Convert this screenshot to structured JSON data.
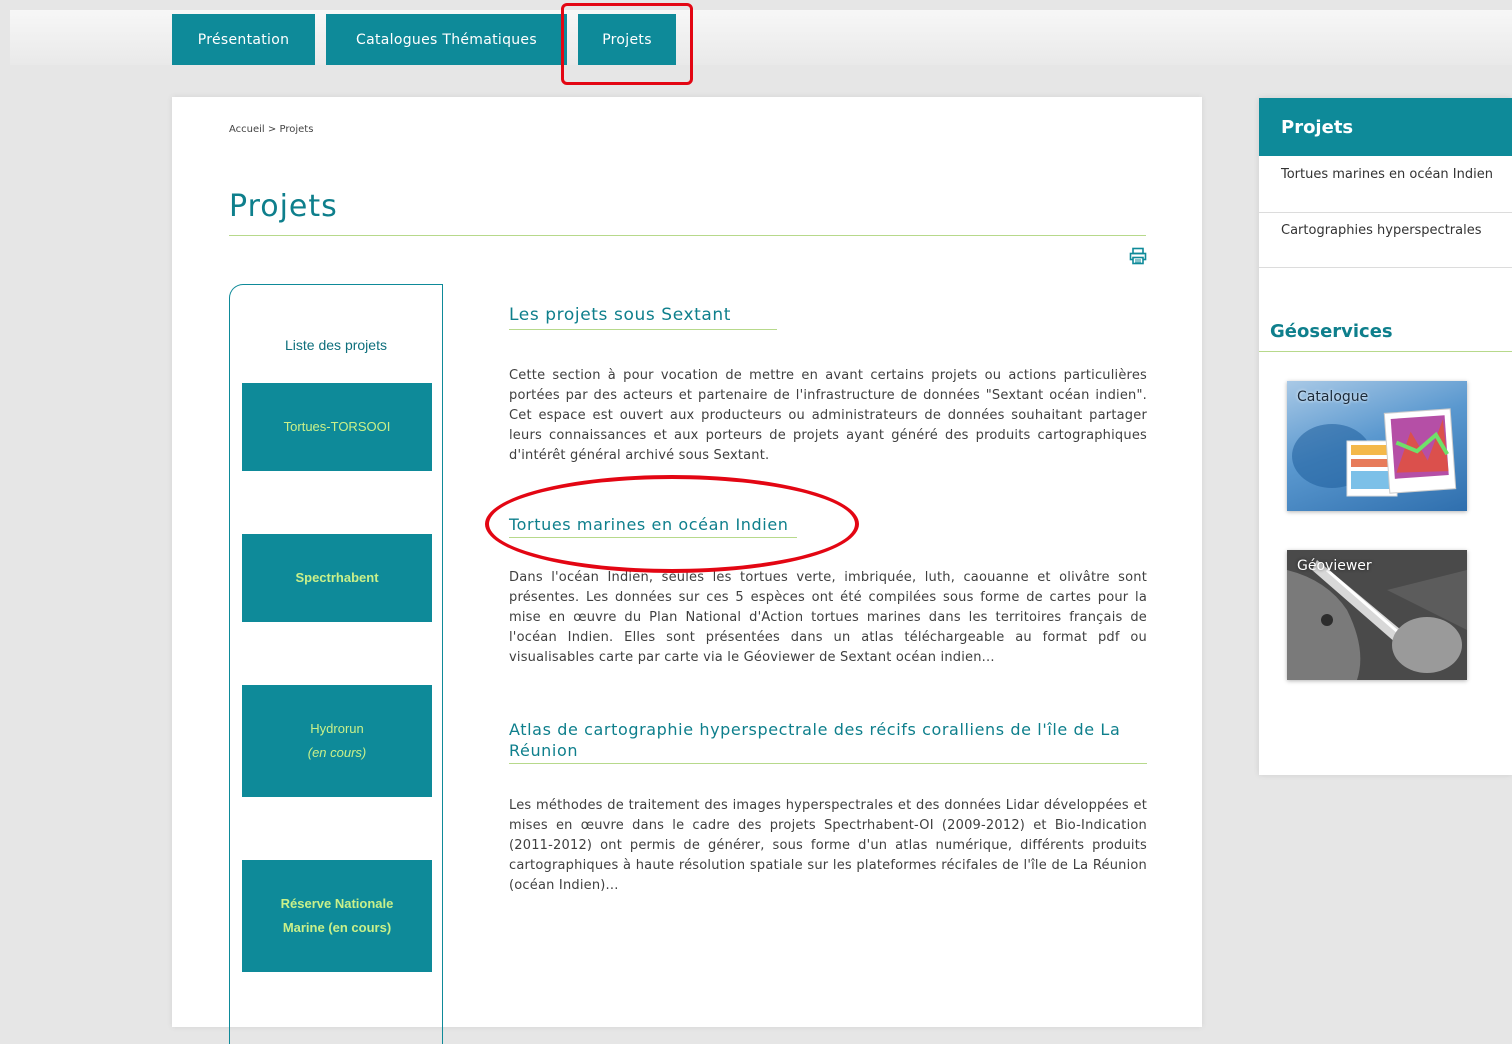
{
  "nav": {
    "tabs": [
      {
        "label": "Présentation"
      },
      {
        "label": "Catalogues Thématiques"
      },
      {
        "label": "Projets"
      }
    ]
  },
  "breadcrumb": {
    "home": "Accueil",
    "separator": ">",
    "current": "Projets"
  },
  "page": {
    "title": "Projets"
  },
  "side_list": {
    "title": "Liste des projets",
    "items": [
      {
        "line1": "Tortues-TORSOOI",
        "line2": ""
      },
      {
        "line1": "Spectrhabent",
        "line2": ""
      },
      {
        "line1": "Hydrorun",
        "line2": "(en cours)"
      },
      {
        "line1": "Réserve Nationale",
        "line2": "Marine (en cours)"
      }
    ]
  },
  "content": {
    "sections": [
      {
        "title": "Les projets sous Sextant",
        "text": "Cette section à pour vocation de mettre en avant certains projets ou actions particulières portées par des acteurs et partenaire de l'infrastructure de données \"Sextant océan indien\". Cet espace est ouvert aux producteurs ou administrateurs de données souhaitant partager leurs connaissances et aux porteurs de projets ayant généré des produits cartographiques d'intérêt général archivé sous Sextant."
      },
      {
        "title": "Tortues marines en océan Indien",
        "text": "Dans l'océan Indien, seules les tortues verte, imbriquée, luth, caouanne et olivâtre sont présentes. Les données sur ces 5 espèces ont été compilées sous forme de cartes pour la mise en œuvre du Plan National d'Action tortues marines dans les territoires français de l'océan Indien. Elles sont présentées dans un atlas téléchargeable au format pdf ou visualisables carte par carte via le Géoviewer de Sextant océan indien..."
      },
      {
        "title": "Atlas de cartographie hyperspectrale des récifs coralliens de l'île de La Réunion",
        "text": "Les méthodes de traitement des images hyperspectrales et des données Lidar développées et mises en œuvre dans le cadre des projets Spectrhabent-OI (2009-2012) et Bio-Indication (2011-2012) ont permis de générer, sous forme d'un atlas numérique, différents produits cartographiques à haute résolution spatiale sur les plateformes récifales de l'île de La Réunion (océan Indien)..."
      }
    ]
  },
  "right_panel": {
    "title": "Projets",
    "items": [
      {
        "label": "Tortues marines en océan Indien"
      },
      {
        "label": "Cartographies hyperspectrales"
      }
    ],
    "geoservices_title": "Géoservices",
    "thumbs": [
      {
        "label": "Catalogue"
      },
      {
        "label": "Géoviewer"
      }
    ]
  },
  "colors": {
    "brand": "#0e8a99",
    "accent_green": "#b7d98b",
    "highlight": "#e30613"
  }
}
